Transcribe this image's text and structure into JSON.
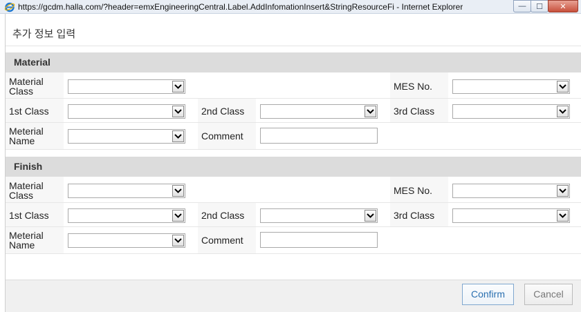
{
  "window": {
    "title": "https://gcdm.halla.com/?header=emxEngineeringCentral.Label.AddInfomationInsert&StringResourceFi - Internet Explorer",
    "minimize": "—",
    "maximize": "☐",
    "close": "✕"
  },
  "popup": {
    "title": "추가 정보 입력"
  },
  "sections": {
    "material": {
      "header": "Material",
      "material_class_line1": "Material",
      "material_class_line2": "Class",
      "mes_no": "MES No.",
      "first_class": "1st Class",
      "second_class": "2nd Class",
      "third_class": "3rd Class",
      "material_name_line1": "Meterial",
      "material_name_line2": "Name",
      "comment": "Comment"
    },
    "finish": {
      "header": "Finish",
      "material_class_line1": "Material",
      "material_class_line2": "Class",
      "mes_no": "MES No.",
      "first_class": "1st Class",
      "second_class": "2nd Class",
      "third_class": "3rd Class",
      "material_name_line1": "Meterial",
      "material_name_line2": "Name",
      "comment": "Comment"
    }
  },
  "buttons": {
    "confirm": "Confirm",
    "cancel": "Cancel"
  }
}
